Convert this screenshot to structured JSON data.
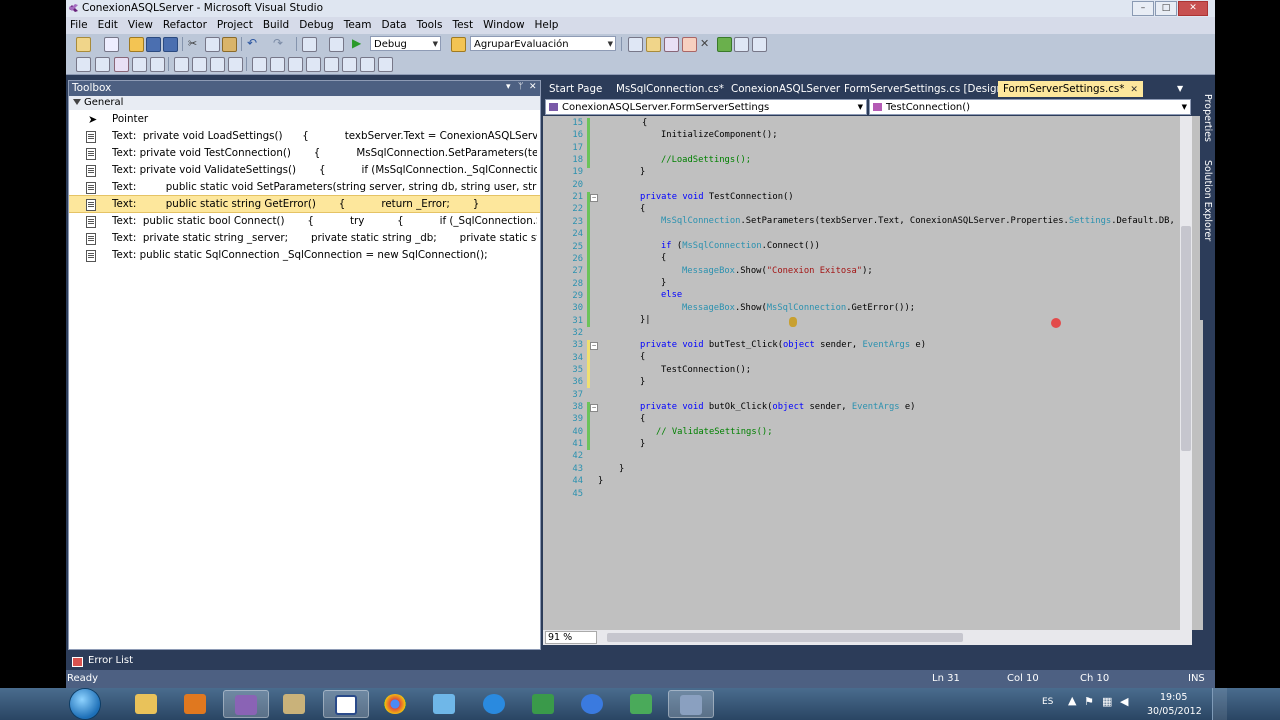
{
  "window": {
    "title": "ConexionASQLServer - Microsoft Visual Studio",
    "controls": [
      "–",
      "□",
      "✕"
    ]
  },
  "menu": [
    "File",
    "Edit",
    "View",
    "Refactor",
    "Project",
    "Build",
    "Debug",
    "Team",
    "Data",
    "Tools",
    "Test",
    "Window",
    "Help"
  ],
  "toolbar": {
    "config": "Debug",
    "find": "AgruparEvaluación"
  },
  "toolbox": {
    "title": "Toolbox",
    "header_controls": [
      "▾",
      "ᛘ",
      "✕"
    ],
    "group": "General",
    "pointer": "Pointer",
    "items": [
      {
        "text": "Text:  private void LoadSettings()      {           texbServer.Text = ConexionASQLServer.Properties.Setti..."
      },
      {
        "text": "Text: private void TestConnection()       {           MsSqlConnection.SetParameters(texbServer.Text, Co..."
      },
      {
        "text": "Text: private void ValidateSettings()       {           if (MsSqlConnection._SqlConnection.State == Conn..."
      },
      {
        "text": "Text:         public static void SetParameters(string server, string db, string user, string pass)       {      ..."
      },
      {
        "text": "Text:         public static string GetError()       {           return _Error;       }"
      },
      {
        "text": "Text:  public static bool Connect()       {           try          {           if (_SqlConnection.State == Conn..."
      },
      {
        "text": "Text:  private static string _server;       private static string _db;       private static string _user;       priv..."
      },
      {
        "text": "Text: public static SqlConnection _SqlConnection = new SqlConnection();"
      }
    ],
    "selected_index": 4
  },
  "editor": {
    "tabs": [
      {
        "label": "Start Page"
      },
      {
        "label": "MsSqlConnection.cs*"
      },
      {
        "label": "ConexionASQLServer"
      },
      {
        "label": "FormServerSettings.cs [Design]*"
      },
      {
        "label": "FormServerSettings.cs*",
        "close": "✕"
      }
    ],
    "active_tab": 4,
    "nav_left": "ConexionASQLServer.FormServerSettings",
    "nav_right": "TestConnection()",
    "line_numbers": [
      "15",
      "16",
      "17",
      "18",
      "19",
      "20",
      "21",
      "22",
      "23",
      "24",
      "25",
      "26",
      "27",
      "28",
      "29",
      "30",
      "31",
      "32",
      "33",
      "34",
      "35",
      "36",
      "37",
      "38",
      "39",
      "40",
      "41",
      "42",
      "43",
      "44",
      "45"
    ],
    "zoom": "91 %"
  },
  "side_tabs": [
    "Properties",
    "Solution Explorer"
  ],
  "bottom": {
    "error_list": "Error List"
  },
  "status": {
    "ready": "Ready",
    "ln": "Ln 31",
    "col": "Col 10",
    "ch": "Ch 10",
    "mode": "INS"
  },
  "taskbar": {
    "lang": "ES",
    "time": "19:05",
    "date": "30/05/2012"
  }
}
